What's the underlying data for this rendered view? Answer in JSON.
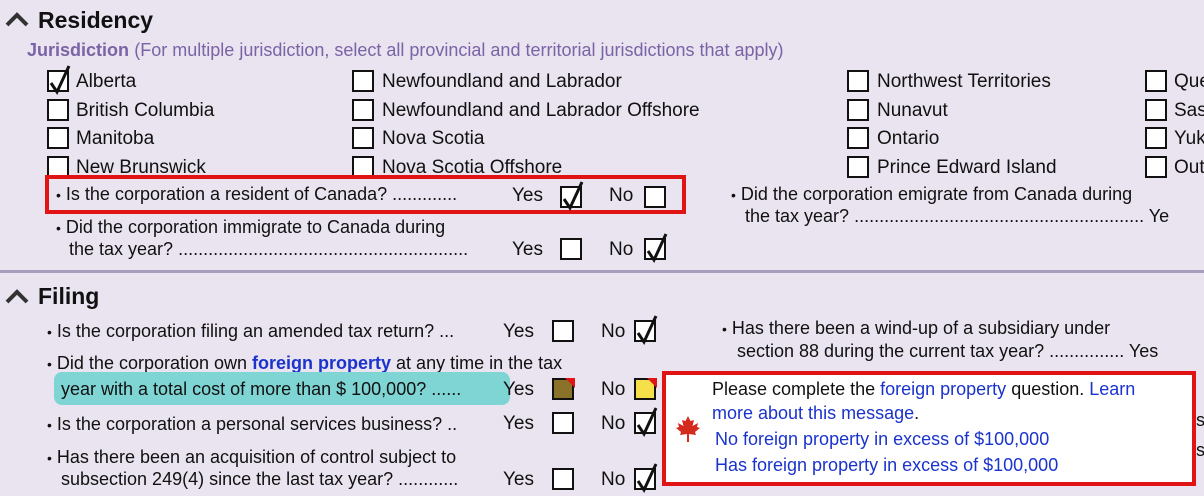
{
  "residency": {
    "title": "Residency",
    "jurisdiction_label": "Jurisdiction",
    "jurisdiction_hint": "(For multiple jurisdiction, select all provincial and territorial jurisdictions that apply)",
    "col1": [
      "Alberta",
      "British Columbia",
      "Manitoba",
      "New Brunswick"
    ],
    "col2": [
      "Newfoundland and Labrador",
      "Newfoundland and Labrador Offshore",
      "Nova Scotia",
      "Nova Scotia Offshore"
    ],
    "col3": [
      "Northwest Territories",
      "Nunavut",
      "Ontario",
      "Prince Edward Island"
    ],
    "col4": [
      "Que",
      "Sas",
      "Yuk",
      "Out"
    ],
    "q_resident": "Is the corporation a resident of Canada? .............",
    "q_immigrate_1": "Did the corporation immigrate to Canada during",
    "q_immigrate_2": "the tax year? ..........................................................",
    "q_emigrate_1": "Did the corporation emigrate from Canada during",
    "q_emigrate_2": "the tax year? .......................................................... Ye"
  },
  "filing": {
    "title": "Filing",
    "q_amended": "Is the corporation filing an amended tax return? ...",
    "q_foreign_1a": "Did the corporation own ",
    "q_foreign_link": "foreign property",
    "q_foreign_1b": " at any time in the tax",
    "q_foreign_2": "year with a total cost of more than $ 100,000? ......",
    "q_personal": "Is the corporation a personal services business? ..",
    "q_acq_1": "Has there been an acquisition of control subject to",
    "q_acq_2": "subsection 249(4) since the last tax year? ............",
    "q_windup_1": "Has there been a wind-up of a subsidiary under",
    "q_windup_2": "section 88 during the current tax year? ............... Yes"
  },
  "yes": "Yes",
  "no": "No",
  "popup": {
    "line1_a": "Please complete the ",
    "line1_link": "foreign property",
    "line1_b": " question. ",
    "line1_learn": "Learn",
    "line2": "more about this message",
    "line2_end": ".",
    "option1": "No foreign property in excess of $100,000",
    "option2": "Has foreign property in excess of $100,000",
    "side_char": "s"
  },
  "colors": {
    "accent_red": "#e01414",
    "link_blue": "#1a33cc",
    "teal": "#7fd4d4",
    "purple": "#7a63a6",
    "flag_red": "#d52b1e"
  }
}
